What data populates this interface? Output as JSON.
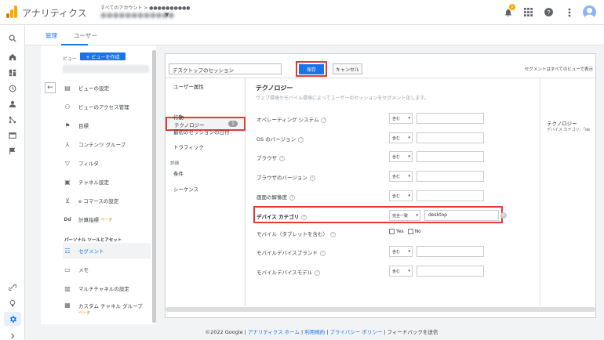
{
  "app": {
    "title": "アナリティクス",
    "account_path": "すべてのアカウント > ●●●●●●●●●●",
    "account_name": "●●●●●●●●●●●●",
    "notification_count": "1",
    "brand_colors": {
      "logo_bar1": "#f9ab00",
      "logo_bar2": "#e37400",
      "accent": "#1a73e8",
      "highlight": "#e53935"
    }
  },
  "rail_icons": [
    "search-icon",
    "home-icon",
    "dashboard-icon",
    "clock-icon",
    "person-icon",
    "branch-icon",
    "display-icon",
    "flag-icon",
    "link-icon",
    "lightbulb-icon",
    "gear-icon",
    "expand-icon"
  ],
  "tabs": {
    "admin": "管理",
    "user": "ユーザー"
  },
  "view_panel": {
    "view_label": "ビュー",
    "create_view": "+ ビューを作成",
    "items": [
      {
        "label": "ビューの設定",
        "icon": "document-icon"
      },
      {
        "label": "ビューのアクセス管理",
        "icon": "people-icon"
      },
      {
        "label": "目標",
        "icon": "flag-icon"
      },
      {
        "label": "コンテンツ グループ",
        "icon": "figure-icon"
      },
      {
        "label": "フィルタ",
        "icon": "filter-icon"
      },
      {
        "label": "チャネル設定",
        "icon": "channel-icon"
      },
      {
        "label": "e コマースの設定",
        "icon": "cart-icon"
      },
      {
        "label": "計算指標",
        "icon": "dd-icon",
        "beta": "ベータ"
      }
    ],
    "section_title": "パーソナル ツールとアセット",
    "personal_items": [
      {
        "label": "セグメント",
        "icon": "segment-icon"
      },
      {
        "label": "メモ",
        "icon": "note-icon"
      },
      {
        "label": "マルチチャネルの設定",
        "icon": "bar-icon"
      },
      {
        "label": "カスタム チャネル グループ",
        "icon": "custom-icon",
        "beta": "ベータ"
      }
    ]
  },
  "segment_editor": {
    "segment_name": "デスクトップのセッション",
    "save_label": "保存",
    "cancel_label": "キャンセル",
    "visibility_note": "セグメントはすべてのビューで表示",
    "categories": [
      "ユーザー属性",
      "テクノロジー",
      "行動",
      "最初のセッションの日付",
      "トラフィック"
    ],
    "technology_count": "1",
    "advanced_label": "詳細",
    "advanced_items": [
      "条件",
      "シーケンス"
    ],
    "section_title": "テクノロジー",
    "section_subtitle": "ウェブ環境やモバイル環境によってユーザーのセッションをセグメント化します。",
    "rows": [
      {
        "label": "オペレーティング システム",
        "op": "含む"
      },
      {
        "label": "OS のバージョン",
        "op": "含む"
      },
      {
        "label": "ブラウザ",
        "op": "含む"
      },
      {
        "label": "ブラウザのバージョン",
        "op": "含む"
      },
      {
        "label": "画面の解像度",
        "op": "含む"
      }
    ],
    "device_row": {
      "label": "デバイス カテゴリ",
      "op": "完全一致",
      "value": "desktop"
    },
    "mobile_row": {
      "label": "モバイル（タブレットを含む）",
      "yes": "Yes",
      "no": "No"
    },
    "rows_after": [
      {
        "label": "モバイルデバイスブランド",
        "op": "含む"
      },
      {
        "label": "モバイルデバイスモデル",
        "op": "含む"
      }
    ],
    "summary_title": "テクノロジー",
    "summary_text": "デバイス カテゴリ：「de"
  },
  "footer": {
    "copyright": "©2022 Google",
    "links": [
      "アナリティクス ホーム",
      "利用規約",
      "プライバシー ポリシー"
    ],
    "feedback": "フィードバックを送信"
  }
}
